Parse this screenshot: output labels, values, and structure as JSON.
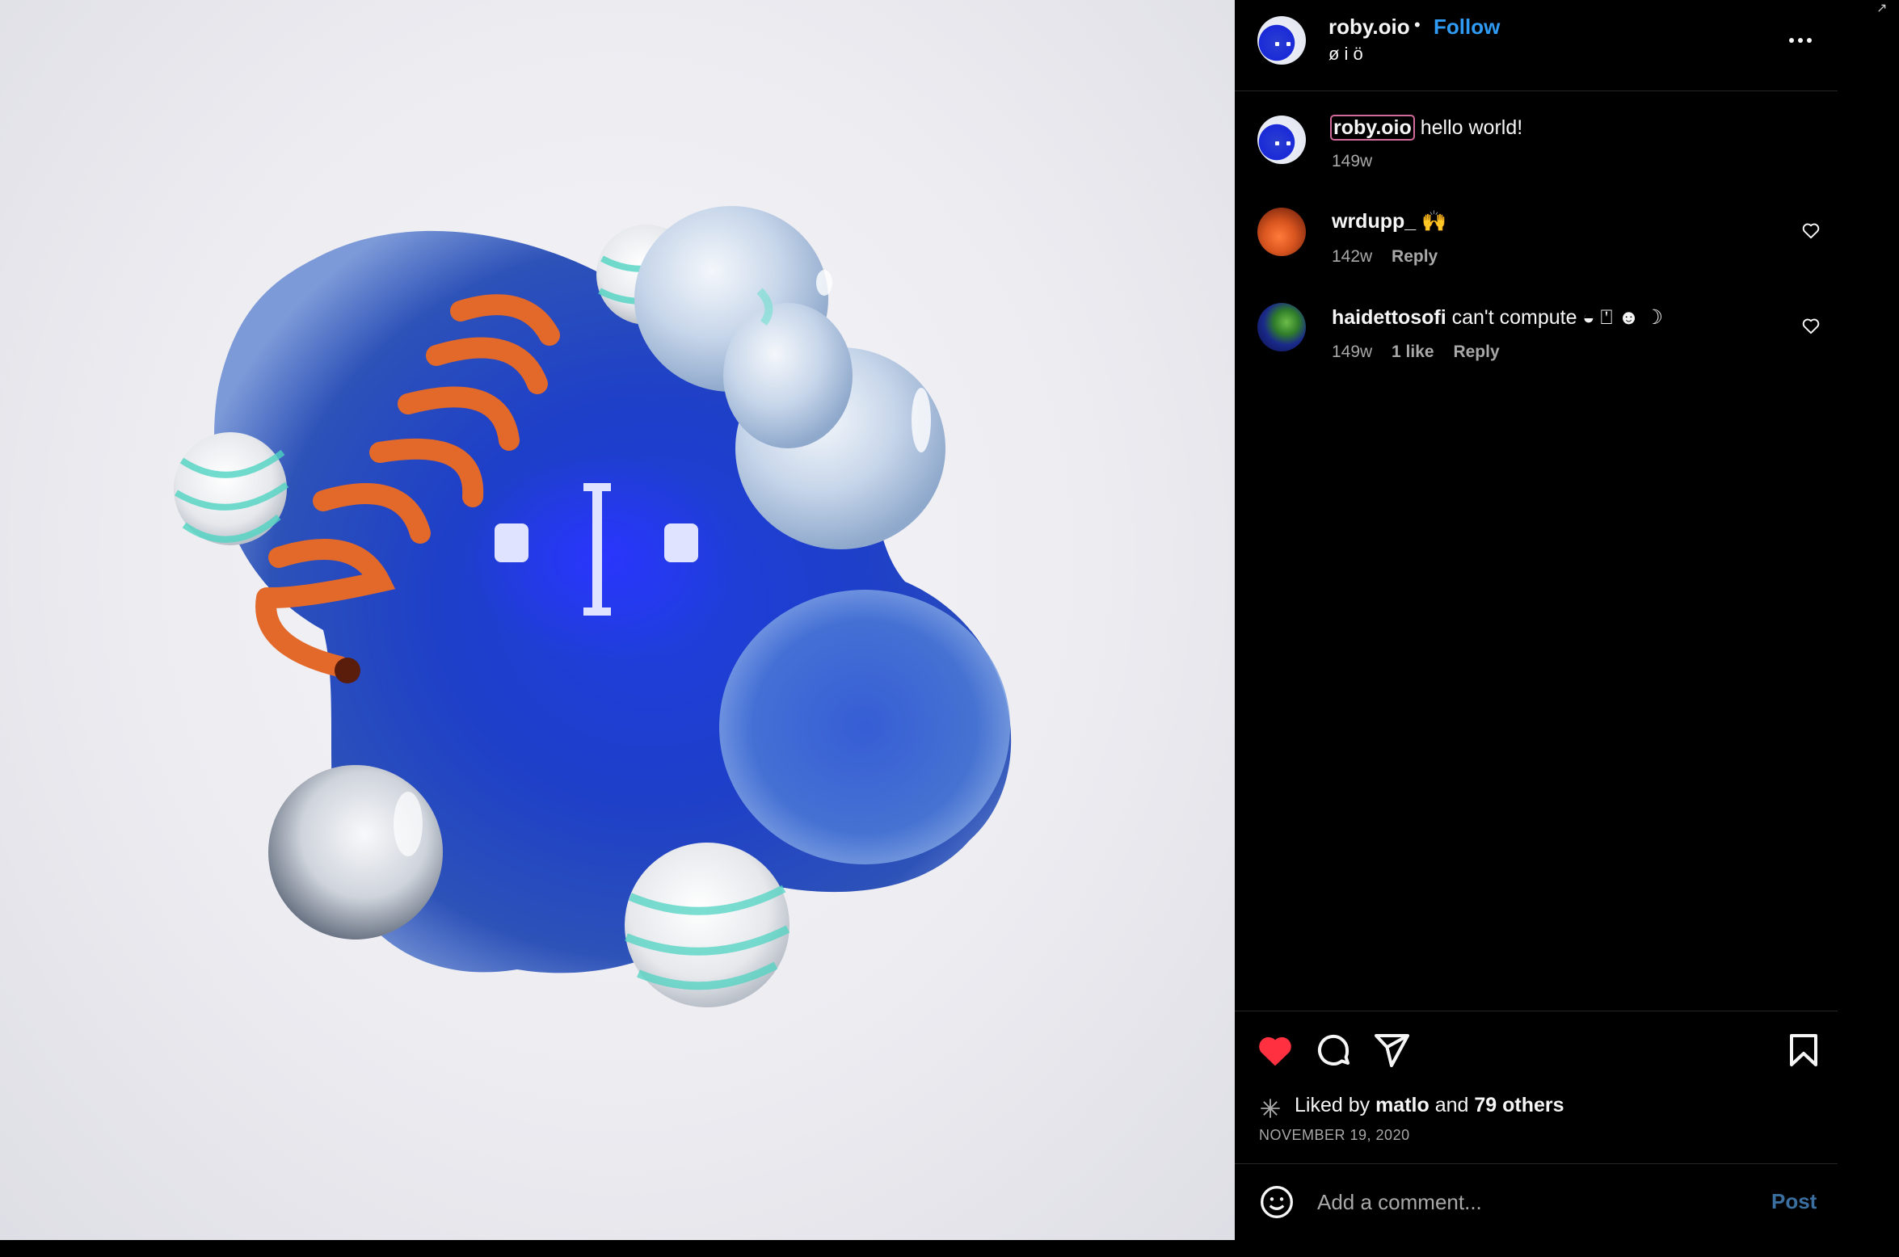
{
  "header": {
    "username": "roby.oio",
    "separator": "•",
    "follow_label": "Follow",
    "subtitle": "ø i ö",
    "more_icon": "more-horizontal-icon"
  },
  "caption": {
    "username": "roby.oio",
    "text": "hello world!",
    "time": "149w"
  },
  "comments": [
    {
      "username": "wrdupp_",
      "text": "🙌",
      "time": "142w",
      "likes": "",
      "reply_label": "Reply"
    },
    {
      "username": "haidettosofi",
      "text": "can't compute ◒ ⍞ ☻ ☽",
      "time": "149w",
      "likes": "1 like",
      "reply_label": "Reply"
    }
  ],
  "actions": {
    "like_icon": "heart-filled-icon",
    "comment_icon": "comment-icon",
    "share_icon": "send-icon",
    "save_icon": "bookmark-icon",
    "like_color": "#ff3040"
  },
  "likes": {
    "prefix": "Liked by",
    "user": "matlo",
    "and": "and",
    "others": "79 others"
  },
  "date": "NOVEMBER 19, 2020",
  "comment_box": {
    "placeholder": "Add a comment...",
    "post_label": "Post",
    "emoji_icon": "smiley-icon"
  },
  "colors": {
    "background": "#000000",
    "link_blue": "#2f9bf5",
    "post_disabled": "#3b6fa0",
    "muted": "#a8a8a8"
  }
}
